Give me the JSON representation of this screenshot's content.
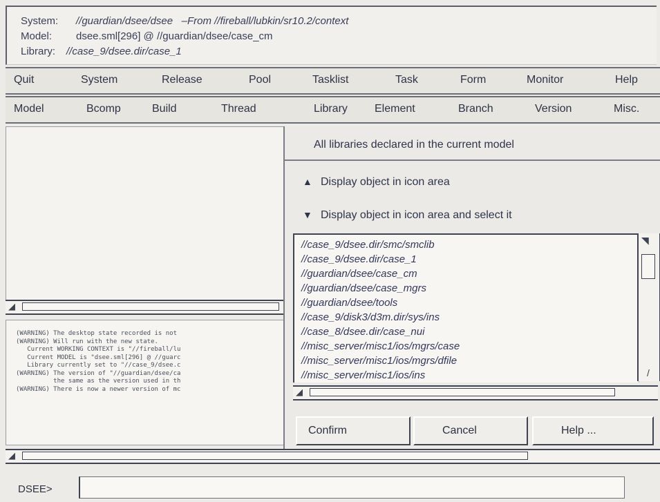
{
  "info": {
    "system_label": "System:",
    "system_value": "//guardian/dsee/dsee",
    "system_from": "–From //fireball/lubkin/sr10.2/context",
    "model_label": "Model:",
    "model_value": "dsee.sml[296] @ //guardian/dsee/case_cm",
    "library_label": "Library:",
    "library_value": "//case_9/dsee.dir/case_1"
  },
  "menubar1": [
    "Quit",
    "System",
    "Release",
    "Pool",
    "Tasklist",
    "Task",
    "Form",
    "Monitor",
    "Help"
  ],
  "menubar2": [
    "Model",
    "Bcomp",
    "Build",
    "Thread",
    "Library",
    "Element",
    "Branch",
    "Version",
    "Misc."
  ],
  "log": [
    "(WARNING) The desktop state recorded is not",
    "(WARNING) Will run with the new state.",
    "   Current WORKING CONTEXT is \"//fireball/lu",
    "   Current MODEL is \"dsee.sml[296] @ //guarc",
    "   Library currently set to \"//case_9/dsee.c",
    "(WARNING) The version of \"//guardian/dsee/ca",
    "          the same as the version used in th",
    "(WARNING) There is now a newer version of mc"
  ],
  "dialog": {
    "title": "All libraries declared in the current model",
    "option_display": "Display object in icon area",
    "option_display_select": "Display object in icon area and select it",
    "icons": {
      "display": "triangle-up-icon",
      "display_select": "chevron-down-icon"
    },
    "libraries": [
      "//case_9/dsee.dir/smc/smclib",
      "//case_9/dsee.dir/case_1",
      "//guardian/dsee/case_cm",
      "//guardian/dsee/case_mgrs",
      "//guardian/dsee/tools",
      "//case_9/disk3/d3m.dir/sys/ins",
      "//case_8/dsee.dir/case_nui",
      "//misc_server/misc1/ios/mgrs/case",
      "//misc_server/misc1/ios/mgrs/dfile",
      "//misc_server/misc1/ios/ins"
    ],
    "buttons": {
      "confirm": "Confirm",
      "cancel": "Cancel",
      "help": "Help ..."
    }
  },
  "prompt": {
    "label": "DSEE>",
    "value": ""
  }
}
